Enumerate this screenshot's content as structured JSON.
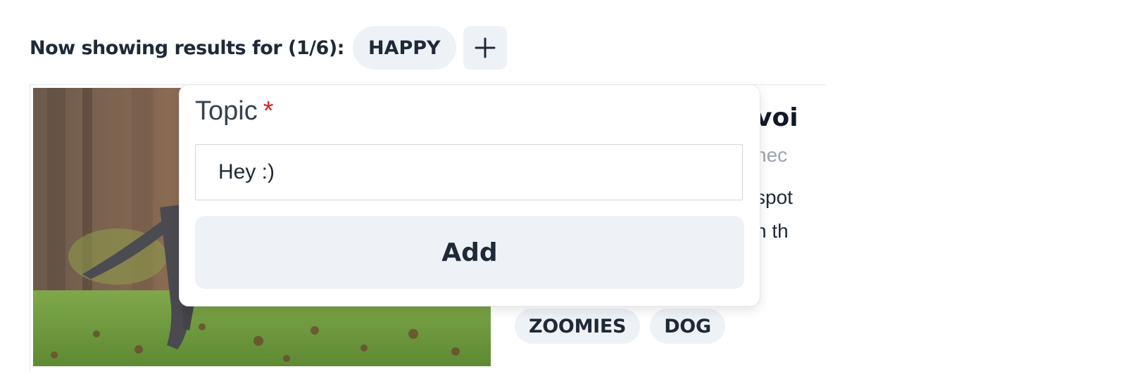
{
  "results_bar": {
    "label": "Now showing results for (1/6):",
    "active_topic": "HAPPY",
    "add_icon": "plus-icon"
  },
  "card": {
    "title_fragment": "voi",
    "meta_fragment": "hec",
    "description_line_1": "spot",
    "description_line_2": "n th",
    "tags": [
      "ZOOMIES",
      "DOG"
    ]
  },
  "popover": {
    "label": "Topic",
    "required_mark": "*",
    "input_value": "Hey :)",
    "submit_label": "Add"
  },
  "colors": {
    "chip_bg": "#eef2f7",
    "required": "#dc2626",
    "text": "#1f2937"
  }
}
